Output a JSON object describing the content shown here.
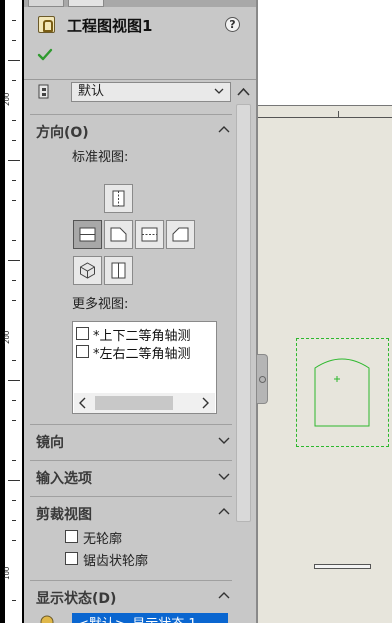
{
  "ruler": {
    "labels": [
      "200",
      "200",
      "100"
    ]
  },
  "panel": {
    "title": "工程图视图1",
    "help_symbol": "?",
    "sheet_format": "默认",
    "sections": {
      "orientation": {
        "label": "方向(O)",
        "standard_views_label": "标准视图:",
        "more_views_label": "更多视图:"
      },
      "mirror": {
        "label": "镜向"
      },
      "import_options": {
        "label": "输入选项"
      },
      "crop_view": {
        "label": "剪裁视图",
        "options": [
          "无轮廓",
          "锯齿状轮廓"
        ]
      },
      "display_state": {
        "label": "显示状态(D)",
        "selected_item": "<默认>_显示状态 1"
      }
    },
    "more_views": [
      "*上下二等角轴测",
      "*左右二等角轴测"
    ]
  },
  "icons": {
    "title": "drawing-view-icon",
    "ok": "checkmark-icon",
    "help": "help-icon",
    "format": "sheet-format-icon"
  },
  "colors": {
    "panel_bg": "#c8c8c8",
    "accent_selection": "#0a66d0",
    "ok_green": "#2f9a2f",
    "view_frame": "#2db82d",
    "sheet_bg": "#e7e5dc"
  }
}
